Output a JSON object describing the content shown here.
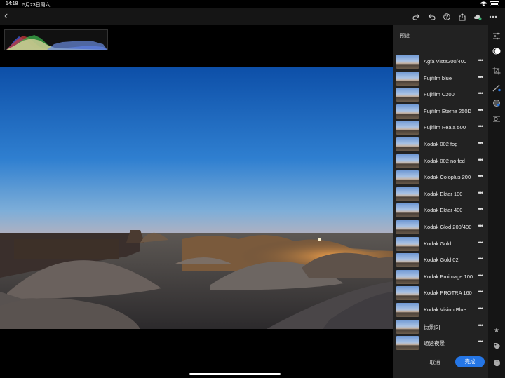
{
  "status_bar": {
    "time": "14:18",
    "date": "5月23日周六"
  },
  "panel": {
    "title": "预设",
    "presets": [
      "Agfa Vista200/400",
      "Fujifilm blue",
      "Fujifilm C200",
      "Fujifilm Eterna 250D",
      "Fujifilm Reala 500",
      "Kodak 002 fog",
      "Kodak 002 no fed",
      "Kodak Coloplus 200",
      "Kodak Ektar 100",
      "Kodak Ektar 400",
      "Kodak Glod 200/400",
      "Kodak Gold",
      "Kodak Gold 02",
      "Kodak Proimage 100",
      "Kodak PROTRA 160",
      "Kodak Vision Blue",
      "街景[2]",
      "通透夜景"
    ],
    "more_glyph": "•••",
    "cancel_label": "取消",
    "done_label": "完成"
  },
  "colors": {
    "accent": "#2576e6",
    "panel_bg": "#222222",
    "toolbar_bg": "#151515"
  },
  "icons": {
    "toolbar": [
      "redo-icon",
      "undo-icon",
      "help-icon",
      "share-icon",
      "cloud-sync-icon",
      "more-icon"
    ],
    "rail": [
      "sliders-icon",
      "presets-icon",
      "crop-icon",
      "healing-icon",
      "mask-icon",
      "versions-icon",
      "star-icon",
      "tag-icon",
      "info-icon"
    ]
  }
}
